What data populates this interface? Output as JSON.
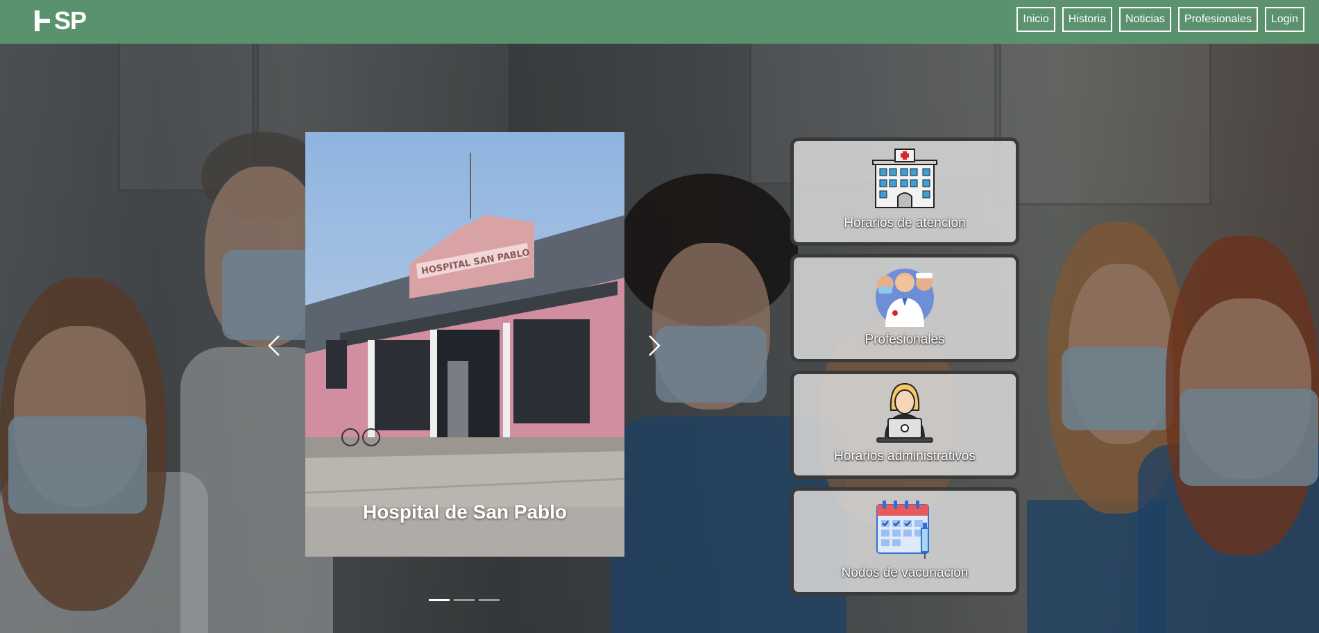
{
  "brand": {
    "logo_text": "SP"
  },
  "nav": {
    "links": [
      {
        "label": "Inicio"
      },
      {
        "label": "Historia"
      },
      {
        "label": "Noticias"
      },
      {
        "label": "Profesionales"
      },
      {
        "label": "Login"
      }
    ]
  },
  "carousel": {
    "caption": "Hospital de San Pablo",
    "building_sign": "HOSPITAL SAN PABLO",
    "active_index": 0,
    "slide_count": 3
  },
  "cards": [
    {
      "label": "Horarios de atencion",
      "icon": "hospital-icon"
    },
    {
      "label": "Profesionales",
      "icon": "medical-staff-icon"
    },
    {
      "label": "Horarios administrativos",
      "icon": "admin-worker-icon"
    },
    {
      "label": "Nodos de vacunacion",
      "icon": "vaccination-calendar-icon"
    }
  ],
  "colors": {
    "navbar": "#5c9670",
    "card_border": "#3a3a3a",
    "card_bg": "#d6d6d6"
  }
}
